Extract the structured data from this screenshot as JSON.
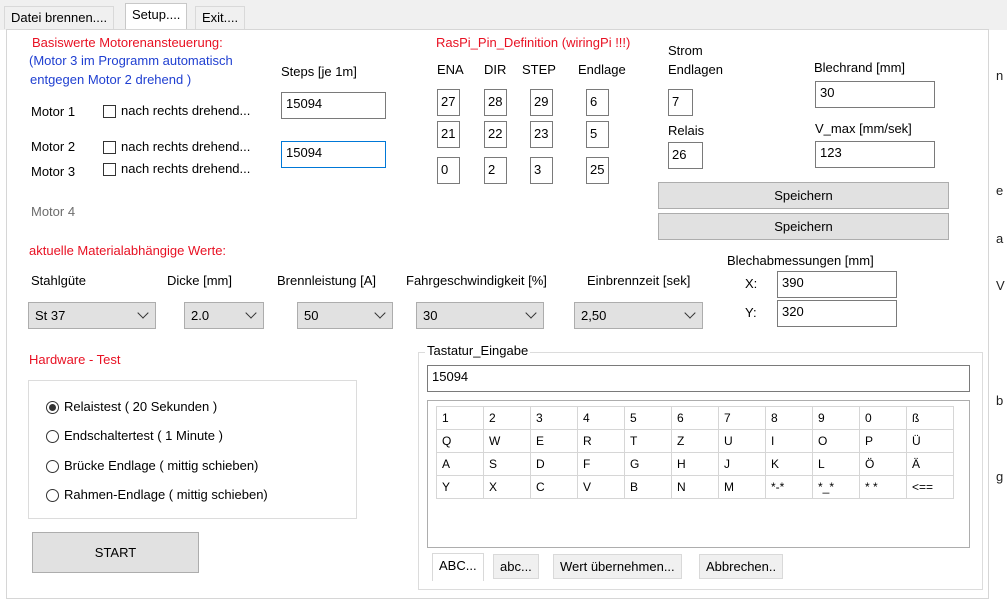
{
  "tabs": [
    "Datei brennen....",
    "Setup....",
    "Exit...."
  ],
  "motor": {
    "section_title": "Basiswerte Motorenansteuerung:",
    "note_line1": "(Motor 3 im Programm automatisch",
    "note_line2": "entgegen Motor 2 drehend )",
    "steps_label": "Steps [je 1m]",
    "motor1_label": "Motor 1",
    "motor2_label": "Motor 2",
    "motor3_label": "Motor 3",
    "motor4_label": "Motor 4",
    "check_label": "nach rechts drehend...",
    "steps1_value": "15094",
    "steps2_value": "15094"
  },
  "raspi": {
    "title": "RasPi_Pin_Definition (wiringPi !!!)",
    "headers": [
      "ENA",
      "DIR",
      "STEP",
      "Endlage"
    ],
    "rows": [
      [
        "27",
        "28",
        "29",
        "6"
      ],
      [
        "21",
        "22",
        "23",
        "5"
      ],
      [
        "0",
        "2",
        "3",
        "25"
      ]
    ],
    "strom_label_line1": "Strom",
    "strom_label_line2": "Endlagen",
    "strom_value": "7",
    "relais_label": "Relais",
    "relais_value": "26",
    "blechrand_label": "Blechrand [mm]",
    "blechrand_value": "30",
    "vmax_label": "V_max [mm/sek]",
    "vmax_value": "123",
    "save1_label": "Speichern",
    "save2_label": "Speichern"
  },
  "material": {
    "title": "aktuelle Materialabhängige Werte:",
    "stahl_label": "Stahlgüte",
    "stahl_value": "St 37",
    "dicke_label": "Dicke [mm]",
    "dicke_value": "2.0",
    "brenn_label": "Brennleistung [A]",
    "brenn_value": "50",
    "fahr_label": "Fahrgeschwindigkeit [%]",
    "fahr_value": "30",
    "einbrenn_label": "Einbrennzeit [sek]",
    "einbrenn_value": "2,50",
    "blech_label": "Blechabmessungen [mm]",
    "x_label": "X:",
    "x_value": "390",
    "y_label": "Y:",
    "y_value": "320"
  },
  "hardware": {
    "title": "Hardware - Test",
    "options": [
      "Relaistest ( 20 Sekunden )",
      "Endschaltertest ( 1 Minute )",
      "Brücke Endlage ( mittig schieben)",
      "Rahmen-Endlage ( mittig schieben)"
    ],
    "start_label": "START"
  },
  "keyboard": {
    "group_label": "Tastatur_Eingabe",
    "input_value": "15094",
    "rows": [
      [
        "1",
        "2",
        "3",
        "4",
        "5",
        "6",
        "7",
        "8",
        "9",
        "0",
        "ß"
      ],
      [
        "Q",
        "W",
        "E",
        "R",
        "T",
        "Z",
        "U",
        "I",
        "O",
        "P",
        "Ü"
      ],
      [
        "A",
        "S",
        "D",
        "F",
        "G",
        "H",
        "J",
        "K",
        "L",
        "Ö",
        "Ä"
      ],
      [
        "Y",
        "X",
        "C",
        "V",
        "B",
        "N",
        "M",
        "*-*",
        "*_*",
        "* *",
        "<=="
      ]
    ],
    "subtabs": [
      "ABC...",
      "abc...",
      "Wert übernehmen...",
      "Abbrechen.."
    ]
  },
  "right_edge": [
    "n",
    "e",
    "a",
    "V",
    "b",
    "g"
  ]
}
